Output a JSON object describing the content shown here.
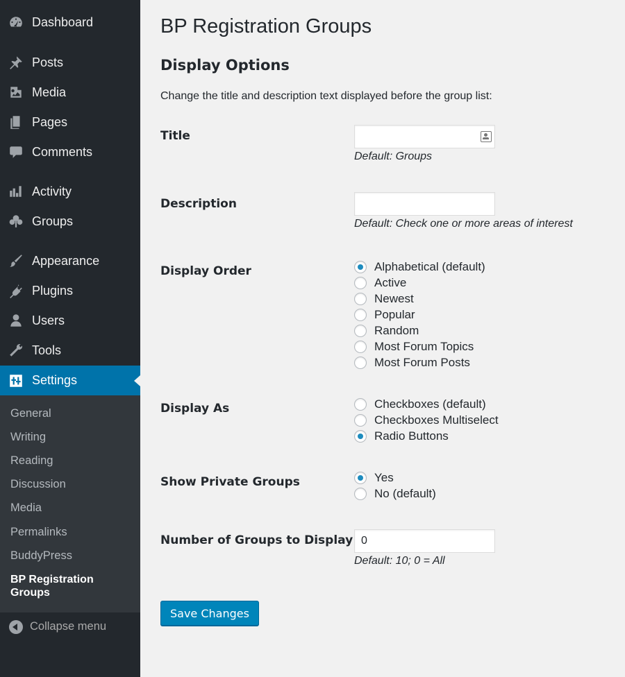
{
  "sidebar": {
    "items": [
      {
        "label": "Dashboard",
        "icon": "dashboard-icon"
      },
      {
        "label": "Posts",
        "icon": "pin-icon"
      },
      {
        "label": "Media",
        "icon": "media-icon"
      },
      {
        "label": "Pages",
        "icon": "pages-icon"
      },
      {
        "label": "Comments",
        "icon": "comment-icon"
      },
      {
        "label": "Activity",
        "icon": "activity-icon"
      },
      {
        "label": "Groups",
        "icon": "groups-icon"
      },
      {
        "label": "Appearance",
        "icon": "brush-icon"
      },
      {
        "label": "Plugins",
        "icon": "plug-icon"
      },
      {
        "label": "Users",
        "icon": "user-icon"
      },
      {
        "label": "Tools",
        "icon": "wrench-icon"
      },
      {
        "label": "Settings",
        "icon": "settings-icon"
      }
    ],
    "submenu": [
      "General",
      "Writing",
      "Reading",
      "Discussion",
      "Media",
      "Permalinks",
      "BuddyPress",
      "BP Registration Groups"
    ],
    "collapse_label": "Collapse menu"
  },
  "page": {
    "title": "BP Registration Groups",
    "section_title": "Display Options",
    "intro": "Change the title and description text displayed before the group list:"
  },
  "form": {
    "title": {
      "label": "Title",
      "value": "",
      "hint": "Default: Groups"
    },
    "description": {
      "label": "Description",
      "value": "",
      "hint": "Default: Check one or more areas of interest"
    },
    "display_order": {
      "label": "Display Order",
      "options": [
        "Alphabetical (default)",
        "Active",
        "Newest",
        "Popular",
        "Random",
        "Most Forum Topics",
        "Most Forum Posts"
      ],
      "selected": "Alphabetical (default)"
    },
    "display_as": {
      "label": "Display As",
      "options": [
        "Checkboxes (default)",
        "Checkboxes Multiselect",
        "Radio Buttons"
      ],
      "selected": "Radio Buttons"
    },
    "show_private": {
      "label": "Show Private Groups",
      "options": [
        "Yes",
        "No (default)"
      ],
      "selected": "Yes"
    },
    "number_of_groups": {
      "label": "Number of Groups to Display",
      "value": "0",
      "hint": "Default: 10; 0 = All"
    },
    "save_label": "Save Changes"
  },
  "colors": {
    "accent": "#0073aa",
    "sidebar_bg": "#23282d",
    "submenu_bg": "#32373c",
    "button": "#0085ba"
  }
}
